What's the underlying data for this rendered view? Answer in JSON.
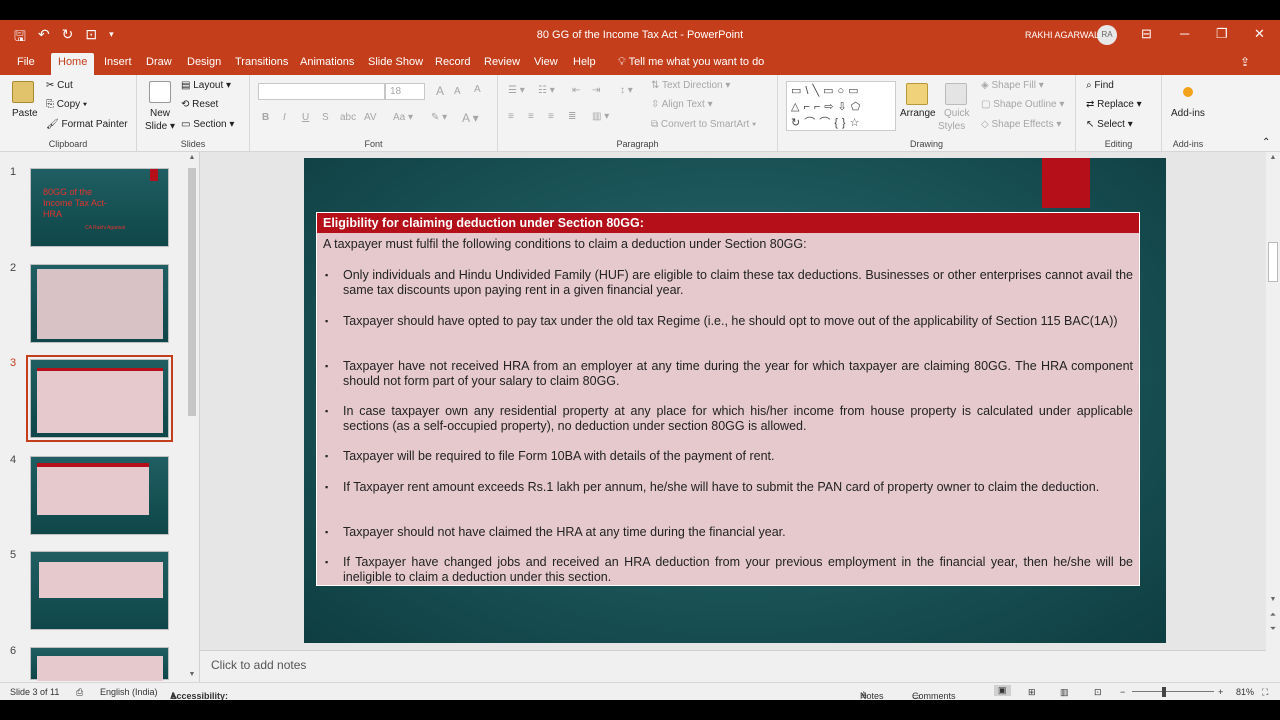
{
  "window": {
    "title": "80 GG of the Income Tax Act  -  PowerPoint",
    "user_name": "RAKHI AGARWAL",
    "user_initials": "RA"
  },
  "tabs": [
    "File",
    "Home",
    "Insert",
    "Draw",
    "Design",
    "Transitions",
    "Animations",
    "Slide Show",
    "Record",
    "Review",
    "View",
    "Help"
  ],
  "active_tab": "Home",
  "tell_me": "Tell me what you want to do",
  "ribbon": {
    "clipboard": {
      "paste": "Paste",
      "cut": "Cut",
      "copy": "Copy",
      "format_painter": "Format Painter",
      "label": "Clipboard"
    },
    "slides": {
      "new_slide_1": "New",
      "new_slide_2": "Slide",
      "layout": "Layout",
      "reset": "Reset",
      "section": "Section",
      "label": "Slides"
    },
    "font": {
      "font_size": "18",
      "label": "Font"
    },
    "paragraph": {
      "text_direction": "Text Direction",
      "align_text": "Align Text",
      "convert_smartart": "Convert to SmartArt",
      "label": "Paragraph"
    },
    "drawing": {
      "arrange": "Arrange",
      "quick_styles_1": "Quick",
      "quick_styles_2": "Styles",
      "shape_fill": "Shape Fill",
      "shape_outline": "Shape Outline",
      "shape_effects": "Shape Effects",
      "label": "Drawing"
    },
    "editing": {
      "find": "Find",
      "replace": "Replace",
      "select": "Select",
      "label": "Editing"
    },
    "addins": {
      "addins": "Add-ins",
      "label": "Add-ins"
    }
  },
  "thumbnails": [
    {
      "num": "1",
      "title_line1": "80GG of the",
      "title_line2": "Income Tax Act-",
      "title_line3": "HRA",
      "author": "CA Rakhi Agarwal"
    },
    {
      "num": "2"
    },
    {
      "num": "3"
    },
    {
      "num": "4"
    },
    {
      "num": "5"
    },
    {
      "num": "6"
    }
  ],
  "slide": {
    "heading": "Eligibility for claiming deduction under Section 80GG:",
    "intro": "A taxpayer must fulfil the following conditions to claim a deduction under Section 80GG:",
    "bullets": [
      "Only individuals and Hindu Undivided Family (HUF) are eligible to claim these tax deductions. Businesses or other enterprises cannot avail the same tax discounts upon paying rent in a given financial year.",
      "Taxpayer should have opted to pay tax under the old tax Regime (i.e., he should opt to move out of the applicability of Section 115 BAC(1A))",
      "Taxpayer have not received HRA from an employer at any time during the year for which taxpayer are claiming 80GG. The HRA component should not form part of your salary to claim 80GG.",
      "In case taxpayer own any residential property at any place for which his/her income from house property is calculated under applicable sections (as a self-occupied property), no deduction under section 80GG is allowed.",
      "Taxpayer will be required to file Form 10BA with details of the payment of rent.",
      "If Taxpayer rent amount exceeds Rs.1 lakh per annum, he/she will have to submit the PAN card of  property owner to claim the deduction.",
      "Taxpayer should not have claimed the HRA at any time during the financial year.",
      "If Taxpayer have changed jobs and received an HRA deduction from your previous employment in the financial year, then he/she will be ineligible to claim a deduction under this section."
    ]
  },
  "notes_placeholder": "Click to add notes",
  "status": {
    "slide_counter": "Slide 3 of 11",
    "language": "English (India)",
    "accessibility": "Accessibility: Investigate",
    "notes": "Notes",
    "comments": "Comments",
    "zoom": "81%"
  },
  "colors": {
    "accent": "#c43e1c",
    "slide_red": "#b5101a",
    "slide_bg": "#1a5357",
    "panel": "#e5c9cd"
  }
}
